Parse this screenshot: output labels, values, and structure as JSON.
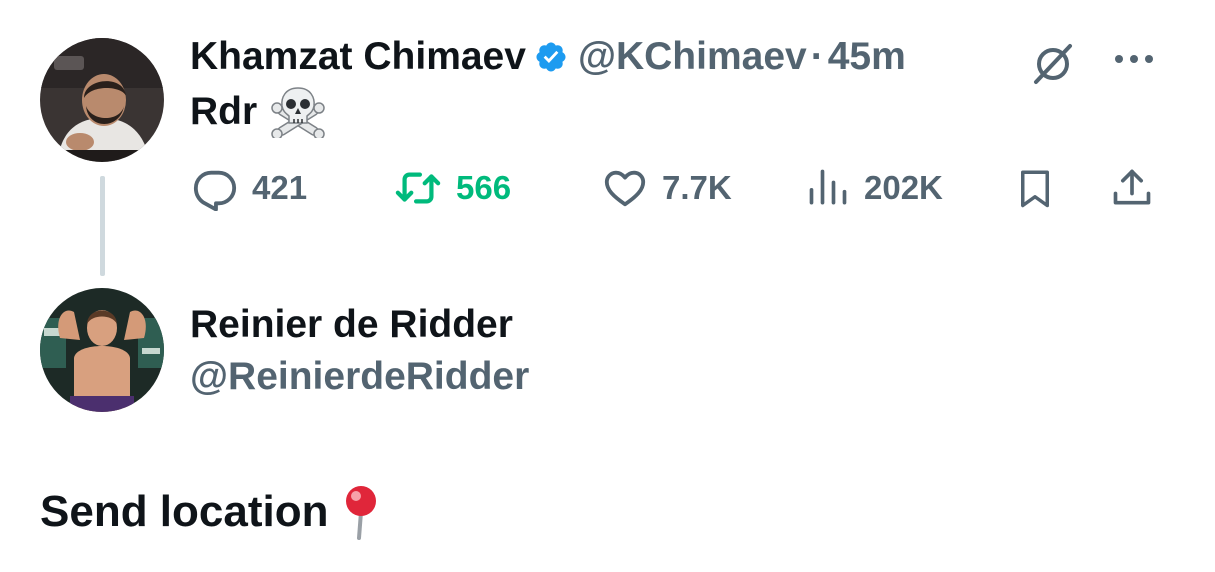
{
  "tweet": {
    "author": {
      "name": "Khamzat Chimaev",
      "handle": "@KChimaev",
      "verified": true,
      "avatar": "avatar-khamzat"
    },
    "separator": "·",
    "time": "45m",
    "text": "Rdr",
    "emoji": "skull-and-crossbones-icon",
    "stats": {
      "replies": "421",
      "retweets": "566",
      "likes": "7.7K",
      "views": "202K"
    }
  },
  "reply": {
    "author": {
      "name": "Reinier de Ridder",
      "handle": "@ReinierdeRidder",
      "avatar": "avatar-reinier"
    },
    "text": "Send location",
    "emoji": "round-pushpin-icon"
  },
  "colors": {
    "text_primary": "#0f1419",
    "text_secondary": "#536471",
    "retweet_green": "#00ba7c",
    "verified_blue": "#1d9bf0",
    "thread_line": "#cfd9de"
  }
}
